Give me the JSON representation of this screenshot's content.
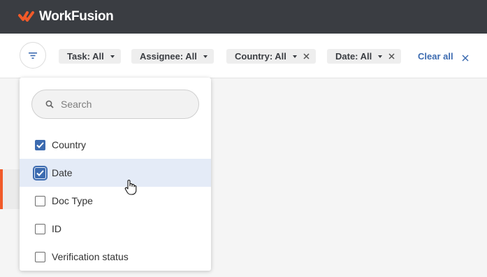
{
  "app": {
    "name": "WorkFusion"
  },
  "filters": [
    {
      "label": "Task: All",
      "removable": false
    },
    {
      "label": "Assignee: All",
      "removable": false
    },
    {
      "label": "Country: All",
      "removable": true
    },
    {
      "label": "Date: All",
      "removable": true
    }
  ],
  "clear_all_label": "Clear all",
  "dropdown": {
    "search_placeholder": "Search",
    "options": [
      {
        "label": "Country",
        "checked": true
      },
      {
        "label": "Date",
        "checked": true
      },
      {
        "label": "Doc Type",
        "checked": false
      },
      {
        "label": "ID",
        "checked": false
      },
      {
        "label": "Verification status",
        "checked": false
      }
    ]
  },
  "colors": {
    "topbar": "#3a3d42",
    "brand": "#f15a29",
    "accent": "#3c6bb0",
    "hover_row": "#e4ebf7"
  }
}
